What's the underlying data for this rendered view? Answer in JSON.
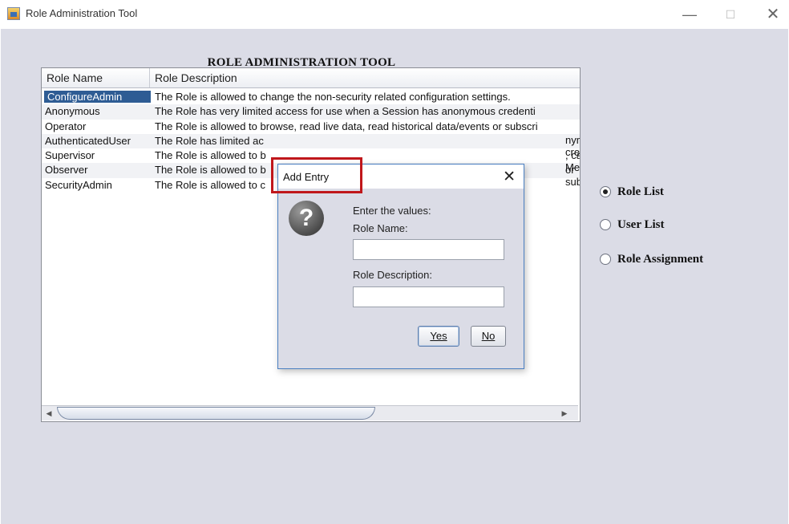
{
  "window": {
    "title": "Role Administration Tool",
    "controls": {
      "minimize": "—",
      "maximize": "☐",
      "close": "✕"
    }
  },
  "heading": "ROLE ADMINISTRATION TOOL",
  "table": {
    "columns": [
      "Role Name",
      "Role Description"
    ],
    "rows": [
      {
        "name": "ConfigureAdmin",
        "description": "The Role is allowed to change the non-security related configuration settings.",
        "selected": true
      },
      {
        "name": "Anonymous",
        "description": "The Role has very limited access for use when a Session has anonymous credenti"
      },
      {
        "name": "Operator",
        "description": "The Role is allowed to browse, read live data, read historical data/events or subscri"
      },
      {
        "name": "AuthenticatedUser",
        "description": "The Role has limited ac"
      },
      {
        "name": "Supervisor",
        "description": "The Role is allowed to b"
      },
      {
        "name": "Observer",
        "description": "The Role is allowed to b"
      },
      {
        "name": "SecurityAdmin",
        "description": "The Role is allowed to c"
      }
    ],
    "peek_texts": [
      "nymous cre",
      ", call Metho",
      "or subscri"
    ]
  },
  "radios": [
    {
      "label": "Role List",
      "checked": true
    },
    {
      "label": "User List",
      "checked": false
    },
    {
      "label": "Role Assignment",
      "checked": false
    }
  ],
  "dialog": {
    "title": "Add Entry",
    "close": "✕",
    "icon": "question-icon",
    "prompt": "Enter the values:",
    "role_name_label": "Role Name:",
    "role_name_value": "",
    "role_desc_label": "Role Description:",
    "role_desc_value": "",
    "yes_label": "Yes",
    "no_label": "No"
  },
  "colors": {
    "highlight": "#c0171b",
    "selection": "#2e5c94",
    "background": "#dbdce6"
  }
}
